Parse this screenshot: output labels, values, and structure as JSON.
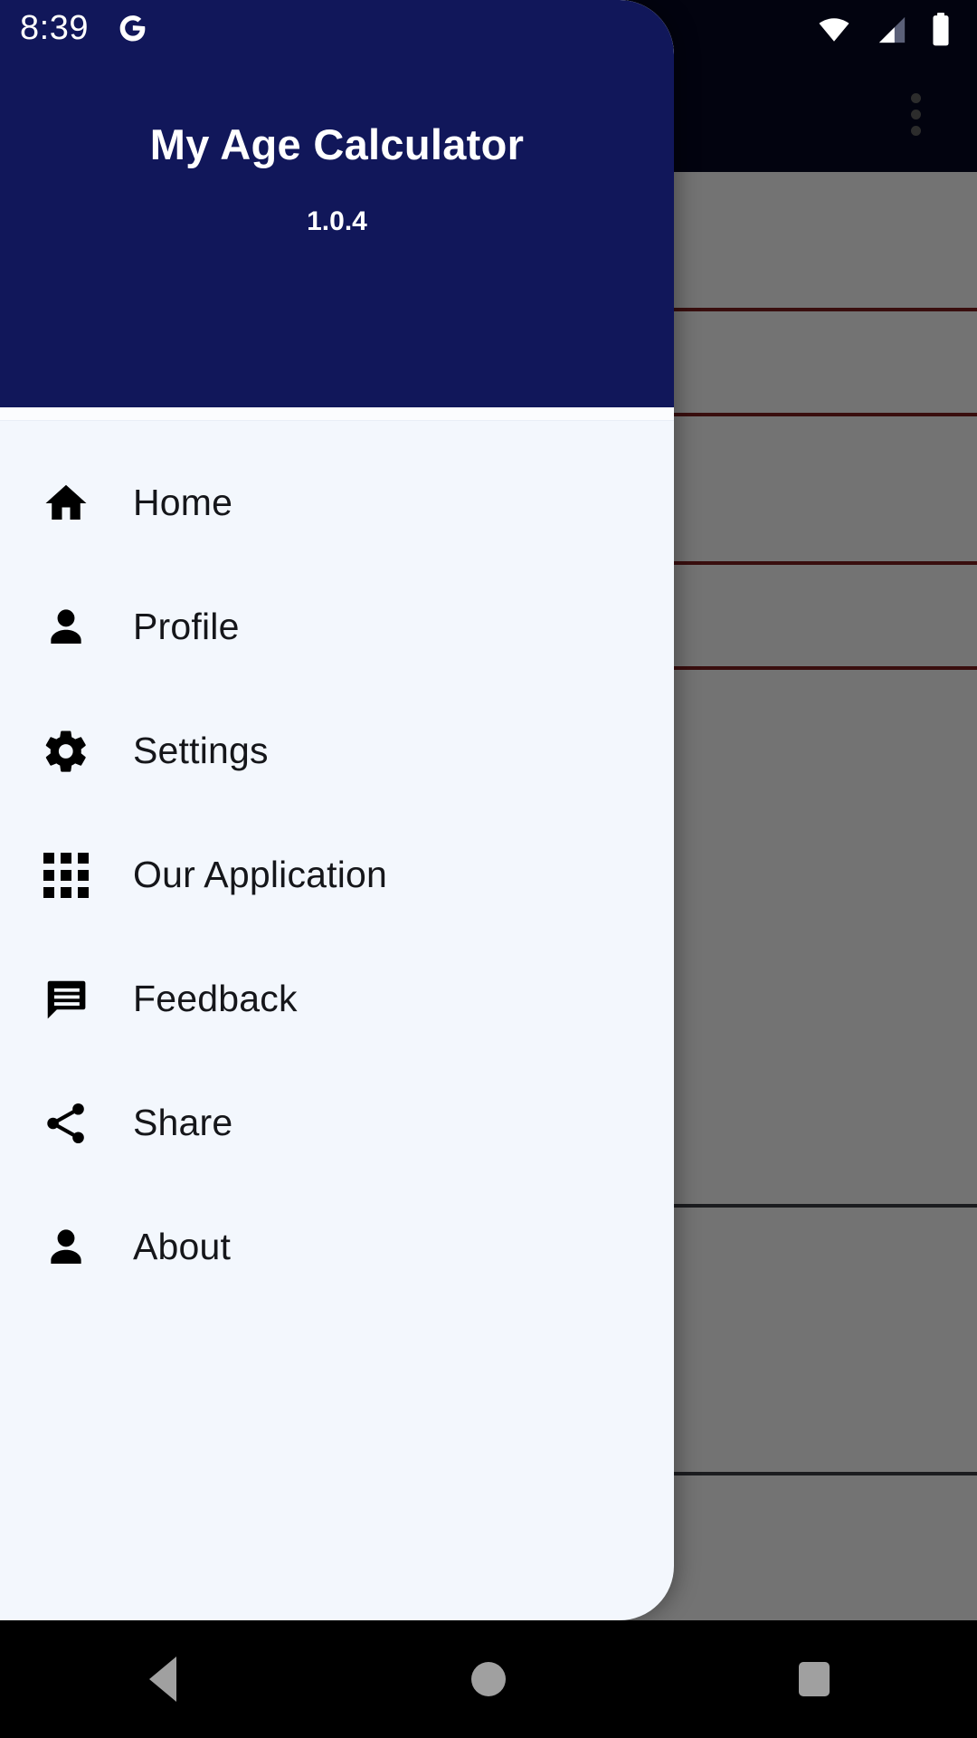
{
  "status_bar": {
    "time": "8:39",
    "google_icon": "google-g-icon",
    "wifi_icon": "wifi-icon",
    "signal_icon": "cell-signal-icon",
    "battery_icon": "battery-full-icon"
  },
  "app_background": {
    "overflow_menu_icon": "more-vert-icon"
  },
  "drawer": {
    "title": "My Age Calculator",
    "version": "1.0.4",
    "items": [
      {
        "label": "Home",
        "icon": "home-icon"
      },
      {
        "label": "Profile",
        "icon": "person-icon"
      },
      {
        "label": "Settings",
        "icon": "gear-icon"
      },
      {
        "label": "Our Application",
        "icon": "apps-grid-icon"
      },
      {
        "label": "Feedback",
        "icon": "chat-bubble-icon"
      },
      {
        "label": "Share",
        "icon": "share-icon"
      },
      {
        "label": "About",
        "icon": "person-icon"
      }
    ]
  },
  "navigation_bar": {
    "back_label": "Back",
    "home_label": "Home",
    "recents_label": "Recents"
  },
  "colors": {
    "header": "#11175A",
    "drawer_body": "#f3f7fd",
    "scrim": "rgba(0,0,0,0.55)",
    "card_outline": "#7e2020",
    "navbar": "#000000"
  }
}
